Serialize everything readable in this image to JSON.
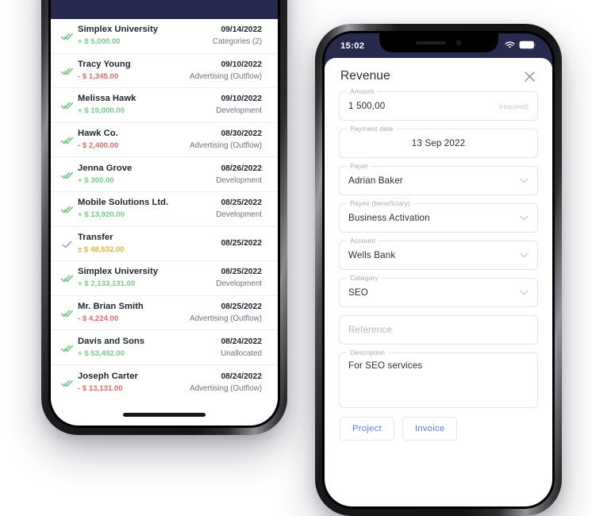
{
  "left_phone": {
    "name": "transactions-list-phone",
    "topbar_color": "#272a4e",
    "transactions": [
      {
        "status": "double-check-green",
        "name": "Simplex University",
        "amount": "+ $ 5,000.00",
        "amount_type": "positive",
        "date": "09/14/2022",
        "category": "Categories (2)"
      },
      {
        "status": "double-check-green",
        "name": "Tracy Young",
        "amount": "- $ 1,345.00",
        "amount_type": "negative",
        "date": "09/10/2022",
        "category": "Advertising (Outflow)"
      },
      {
        "status": "double-check-green",
        "name": "Melissa Hawk",
        "amount": "+ $ 10,000.00",
        "amount_type": "positive",
        "date": "09/10/2022",
        "category": "Development"
      },
      {
        "status": "double-check-green",
        "name": "Hawk Co.",
        "amount": "- $ 2,400.00",
        "amount_type": "negative",
        "date": "08/30/2022",
        "category": "Advertising (Outflow)"
      },
      {
        "status": "double-check-green",
        "name": "Jenna Grove",
        "amount": "+ $ 300.00",
        "amount_type": "positive",
        "date": "08/26/2022",
        "category": "Development"
      },
      {
        "status": "double-check-green",
        "name": "Mobile Solutions Ltd.",
        "amount": "+ $ 13,920.00",
        "amount_type": "positive",
        "date": "08/25/2022",
        "category": "Development"
      },
      {
        "status": "single-check-gray",
        "name": "Transfer",
        "amount": "± $ 48,532.00",
        "amount_type": "neutral",
        "date": "08/25/2022",
        "category": ""
      },
      {
        "status": "double-check-green",
        "name": "Simplex University",
        "amount": "+ $ 2,133,131.00",
        "amount_type": "positive",
        "date": "08/25/2022",
        "category": "Development"
      },
      {
        "status": "double-check-green",
        "name": "Mr. Brian Smith",
        "amount": "- $ 4,224.00",
        "amount_type": "negative",
        "date": "08/25/2022",
        "category": "Advertising (Outflow)"
      },
      {
        "status": "double-check-green",
        "name": "Davis and Sons",
        "amount": "+ $ 53,452.00",
        "amount_type": "positive",
        "date": "08/24/2022",
        "category": "Unallocated"
      },
      {
        "status": "double-check-green",
        "name": "Joseph Carter",
        "amount": "- $ 13,131.00",
        "amount_type": "negative",
        "date": "08/24/2022",
        "category": "Advertising (Outflow)"
      }
    ]
  },
  "right_phone": {
    "name": "revenue-form-phone",
    "statusbar": {
      "time": "15:02",
      "wifi_icon": "wifi-icon",
      "battery_icon": "battery-icon"
    },
    "sheet": {
      "title": "Revenue",
      "close_icon": "close-icon",
      "fields": [
        {
          "label": "Amount",
          "value": "1 500,00",
          "hint": "(required)",
          "kind": "text"
        },
        {
          "label": "Payment date",
          "value": "13 Sep 2022",
          "hint": "",
          "kind": "centered"
        },
        {
          "label": "Payer",
          "value": "Adrian Baker",
          "hint": "",
          "kind": "select"
        },
        {
          "label": "Payee (beneficiary)",
          "value": "Business Activation",
          "hint": "",
          "kind": "select"
        },
        {
          "label": "Account",
          "value": "Wells Bank",
          "hint": "",
          "kind": "select"
        },
        {
          "label": "Category",
          "value": "SEO",
          "hint": "",
          "kind": "select"
        },
        {
          "label": "",
          "value": "",
          "placeholder": "Reference",
          "hint": "",
          "kind": "placeholder"
        },
        {
          "label": "Description",
          "value": "For SEO services",
          "hint": "",
          "kind": "textarea"
        }
      ],
      "buttons": [
        {
          "label": "Project"
        },
        {
          "label": "Invoice"
        }
      ]
    }
  },
  "colors": {
    "navy": "#272a4e",
    "positive_green": "#77c98a",
    "negative_red": "#e2696b",
    "neutral_amber": "#e3b23c",
    "accent_blue": "#6878e0",
    "text_dark": "#23252e",
    "text_muted": "#6e7280"
  }
}
